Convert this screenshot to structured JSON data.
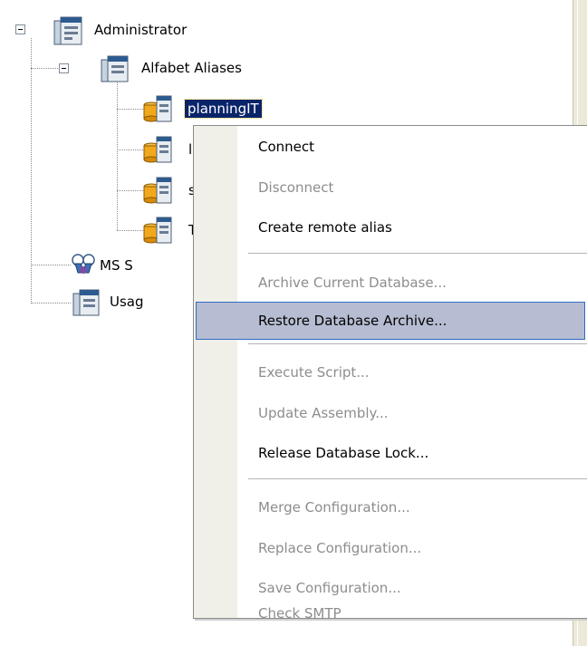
{
  "tree": {
    "root": {
      "label": "Administrator",
      "icon": "server-icon"
    },
    "aliases": {
      "label": "Alfabet Aliases",
      "icon": "server-icon"
    },
    "alias_items": [
      {
        "label": "planningIT",
        "icon": "database-server-icon",
        "selected": true
      },
      {
        "label": "l",
        "icon": "database-server-icon"
      },
      {
        "label": "s",
        "icon": "database-server-icon"
      },
      {
        "label": "T",
        "icon": "database-server-icon"
      }
    ],
    "ms": {
      "label": "MS S",
      "icon": "users-icon"
    },
    "usage": {
      "label": "Usag",
      "icon": "server-icon"
    }
  },
  "context_menu": {
    "items": [
      {
        "label": "Connect",
        "enabled": true
      },
      {
        "label": "Disconnect",
        "enabled": false
      },
      {
        "label": "Create remote alias",
        "enabled": true
      },
      {
        "label": "Archive Current Database...",
        "enabled": false
      },
      {
        "label": "Restore Database Archive...",
        "enabled": true,
        "highlighted": true
      },
      {
        "label": "Execute Script...",
        "enabled": false
      },
      {
        "label": "Update Assembly...",
        "enabled": false
      },
      {
        "label": "Release Database Lock...",
        "enabled": true
      },
      {
        "label": "Merge Configuration...",
        "enabled": false
      },
      {
        "label": "Replace Configuration...",
        "enabled": false
      },
      {
        "label": "Save Configuration...",
        "enabled": false
      },
      {
        "label": "Check SMTP",
        "enabled": false
      }
    ]
  }
}
